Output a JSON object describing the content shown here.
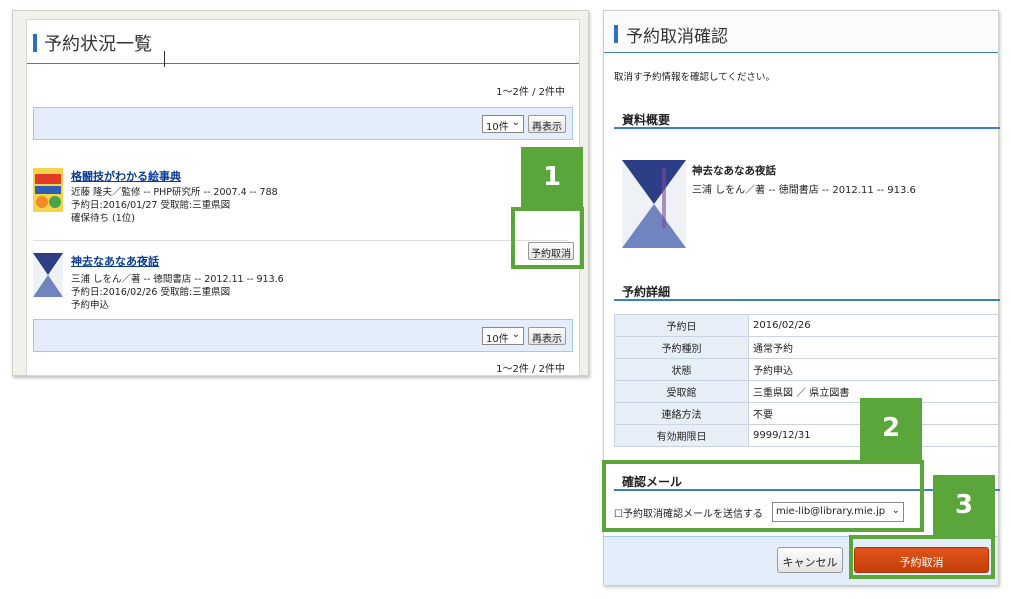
{
  "left": {
    "title": "予約状況一覧",
    "count_text": "1～2件 / 2件中",
    "per_page": "10件",
    "refresh_label": "再表示",
    "items": [
      {
        "title": "格闘技がわかる絵事典",
        "line1": "近藤 隆夫／監修 -- PHP研究所 -- 2007.4 -- 788",
        "line2": "予約日:2016/01/27 受取館:三重県図",
        "line3": "確保待ち (1位)"
      },
      {
        "title": "神去なあなあ夜話",
        "line1": "三浦 しをん／著 -- 徳間書店 -- 2012.11 -- 913.6",
        "line2": "予約日:2016/02/26 受取館:三重県図",
        "line3": "予約申込"
      }
    ],
    "cancel_label": "予約取消"
  },
  "callouts": {
    "c1": "1",
    "c2": "2",
    "c3": "3"
  },
  "callout_color": "#5aa63a",
  "right": {
    "title": "予約取消確認",
    "intro": "取消す予約情報を確認してください。",
    "section_summary": "資料概要",
    "book_title": "神去なあなあ夜話",
    "book_line": "三浦 しをん／著 -- 徳間書店 -- 2012.11 -- 913.6",
    "section_detail": "予約詳細",
    "details": [
      {
        "label": "予約日",
        "value": "2016/02/26"
      },
      {
        "label": "予約種別",
        "value": "通常予約"
      },
      {
        "label": "状態",
        "value": "予約申込"
      },
      {
        "label": "受取館",
        "value": "三重県図 ／ 県立図書"
      },
      {
        "label": "連絡方法",
        "value": "不要"
      },
      {
        "label": "有効期限日",
        "value": "9999/12/31"
      }
    ],
    "section_mail": "確認メール",
    "mail_checkbox_label": "予約取消確認メールを送信する",
    "mail_address": "mie-lib@library.mie.jp",
    "cancel_button": "キャンセル",
    "confirm_button": "予約取消",
    "confirm_color": "#d2490f"
  }
}
